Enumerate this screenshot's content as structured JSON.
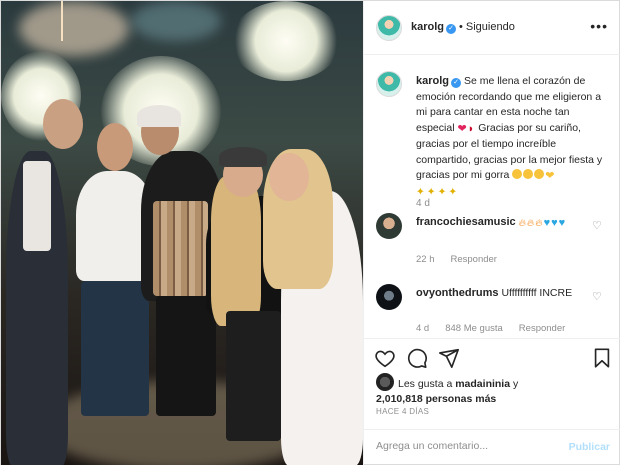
{
  "post": {
    "author": "karolg",
    "follow_status": "Siguiendo",
    "more_label": "•••"
  },
  "caption": {
    "author": "karolg",
    "text_part1": "Se me llena el corazón de emoción recordando que me eligieron a mi para cantar en esta noche tan especial",
    "text_part2": "Gracias por su cariño, gracias por el tiempo increíble compartido, gracias por la mejor fiesta y gracias por mi gorra",
    "time": "4 d"
  },
  "comments": [
    {
      "author": "francochiesamusic",
      "text": "",
      "time": "22 h",
      "reply_label": "Responder"
    },
    {
      "author": "ovyonthedrums",
      "text": "Uffffffffff INCRE",
      "time": "4 d",
      "likes": "848 Me gusta",
      "reply_label": "Responder"
    }
  ],
  "likes": {
    "prefix": "Les gusta a",
    "first_liker": "madaininia",
    "conjunction": "y",
    "others": "2,010,818 personas más"
  },
  "posted_ago": "HACE 4 DÍAS",
  "comment_box": {
    "placeholder": "Agrega un comentario...",
    "post_label": "Publicar"
  },
  "icons": {
    "like": "heart-icon",
    "comment": "comment-icon",
    "share": "share-icon",
    "save": "bookmark-icon",
    "verified": "verified-badge-icon"
  },
  "colors": {
    "accent": "#3897f0",
    "publish_disabled": "#b2dffc",
    "muted": "#8e8e8e"
  }
}
